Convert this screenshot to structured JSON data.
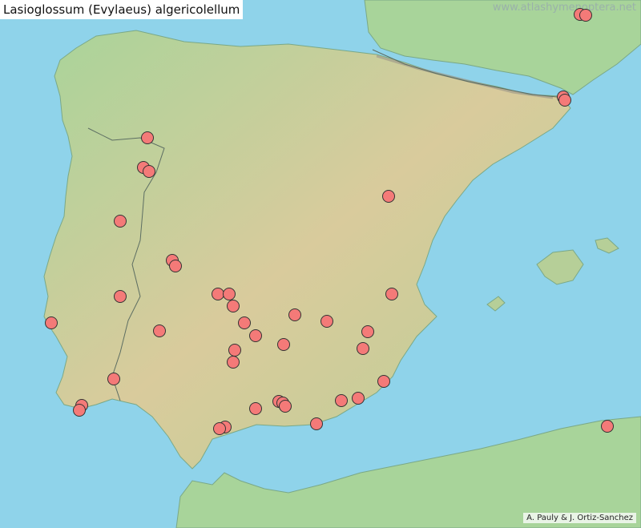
{
  "map": {
    "title": "Lasioglossum (Evylaeus) algericolellum",
    "watermark": "www.atlashymenoptera.net",
    "credit": "A. Pauly & J. Ortiz-Sanchez"
  },
  "colors": {
    "sea": "#8fd3ea",
    "land_low": "#9fcf90",
    "land_high": "#d8c99a",
    "record_marker": "#f47a78",
    "marker_outline": "#333333"
  },
  "record_count": 49
}
